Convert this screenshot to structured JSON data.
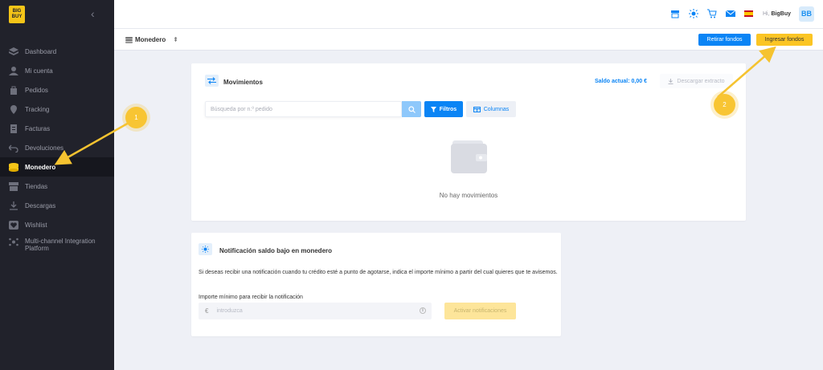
{
  "sidebar": {
    "logo": "BIG BUY",
    "items": [
      {
        "label": "Dashboard",
        "icon": "dashboard-icon"
      },
      {
        "label": "Mi cuenta",
        "icon": "user-icon"
      },
      {
        "label": "Pedidos",
        "icon": "orders-icon"
      },
      {
        "label": "Tracking",
        "icon": "location-icon"
      },
      {
        "label": "Facturas",
        "icon": "invoice-icon"
      },
      {
        "label": "Devoluciones",
        "icon": "returns-icon"
      },
      {
        "label": "Monedero",
        "icon": "wallet-icon"
      },
      {
        "label": "Tiendas",
        "icon": "store-icon"
      },
      {
        "label": "Descargas",
        "icon": "download-icon"
      },
      {
        "label": "Wishlist",
        "icon": "heart-icon"
      },
      {
        "label": "Multi-channel Integration Platform",
        "icon": "integration-icon"
      }
    ]
  },
  "topbar": {
    "greeting": "Hi,",
    "user": "BigBuy",
    "avatar": "BB"
  },
  "subheader": {
    "breadcrumb": "Monedero",
    "up_icon": "⇞",
    "withdraw_label": "Retirar fondos",
    "deposit_label": "Ingresar fondos"
  },
  "movimientos": {
    "title": "Movimientos",
    "balance": "Saldo actual: 0,00 €",
    "download_label": "Descargar extracto",
    "search_placeholder": "Búsqueda por n.º pedido",
    "filters_label": "Filtros",
    "columns_label": "Columnas",
    "empty_text": "No hay movimientos"
  },
  "notification": {
    "title": "Notificación saldo bajo en monedero",
    "description": "Si deseas recibir una notificación cuando tu crédito esté a punto de agotarse, indica el importe mínimo a partir del cual quieres que te avisemos.",
    "amount_label": "Importe mínimo para recibir la notificación",
    "currency": "€",
    "amount_placeholder": "introduzca",
    "activate_label": "Activar notificaciones"
  },
  "annotations": [
    {
      "number": "1"
    },
    {
      "number": "2"
    }
  ],
  "colors": {
    "sidebar_bg": "#21222b",
    "primary_blue": "#0a84f5",
    "accent_yellow": "#fbc524",
    "annotation_yellow": "#f8c533"
  }
}
